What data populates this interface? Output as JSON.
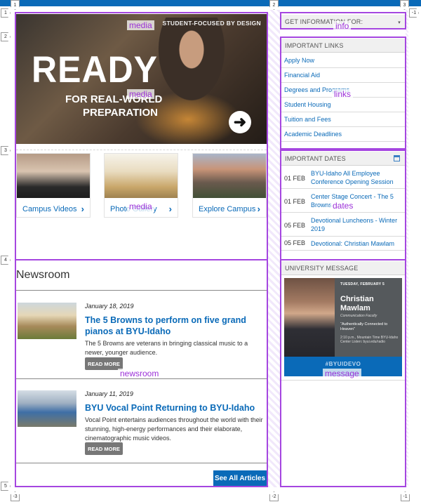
{
  "hero": {
    "tagline": "STUDENT-FOCUSED BY DESIGN",
    "headline": "READY",
    "subline1": "FOR REAL-WORLD",
    "subline2": "PREPARATION",
    "arrow_glyph": "➜"
  },
  "cards": [
    {
      "caption": "Campus Videos",
      "chevron": "›"
    },
    {
      "caption": "Photo Gallery",
      "chevron": "›"
    },
    {
      "caption": "Explore Campus",
      "chevron": "›"
    }
  ],
  "newsroom": {
    "title": "Newsroom",
    "articles": [
      {
        "date": "January 18, 2019",
        "headline": "The 5 Browns to perform on five grand pianos at BYU-Idaho",
        "description": "The 5 Browns are veterans in bringing classical music to a newer, younger audience.",
        "more_label": "READ MORE"
      },
      {
        "date": "January 11, 2019",
        "headline": "BYU Vocal Point Returning to BYU-Idaho",
        "description": "Vocal Point entertains audiences throughout the world with their stunning, high-energy performances and their elaborate, cinematographic music videos.",
        "more_label": "READ MORE"
      }
    ],
    "see_all": "See All Articles"
  },
  "info": {
    "select_label": "GET INFORMATION FOR:",
    "select_arrow": "▾"
  },
  "links": {
    "heading": "IMPORTANT LINKS",
    "items": [
      "Apply Now",
      "Financial Aid",
      "Degrees and Programs",
      "Student Housing",
      "Tuition and Fees",
      "Academic Deadlines"
    ]
  },
  "dates": {
    "heading": "IMPORTANT DATES",
    "items": [
      {
        "date": "01 FEB",
        "title": "BYU-Idaho All Employee Conference Opening Session"
      },
      {
        "date": "01 FEB",
        "title": "Center Stage Concert - The 5 Browns"
      },
      {
        "date": "05 FEB",
        "title": "Devotional Luncheons - Winter 2019"
      },
      {
        "date": "05 FEB",
        "title": "Devotional: Christian Mawlam"
      }
    ]
  },
  "message": {
    "heading": "UNIVERSITY MESSAGE",
    "day": "TUESDAY, FEBRUARY 5",
    "first_name": "Christian",
    "last_name": "Mawlam",
    "role": "Communication Faculty",
    "quote": "“Authentically Connected to Heaven”",
    "details": "2:10 p.m., Mountain Time BYU-Idaho Center Listen: byui.edu/radio",
    "hashtag": "#BYUIDEVO"
  },
  "annotations": {
    "region_labels": [
      "media",
      "media",
      "media",
      "info",
      "links",
      "dates",
      "newsroom",
      "message"
    ],
    "markers": [
      "1",
      "2",
      "3",
      "-1",
      "1",
      "2",
      "3",
      "4",
      "5",
      "-3",
      "-2",
      "-1"
    ]
  },
  "colors": {
    "brand_blue": "#0a6ab8",
    "annotation_purple": "#a546e0",
    "button_gray": "#777777"
  }
}
